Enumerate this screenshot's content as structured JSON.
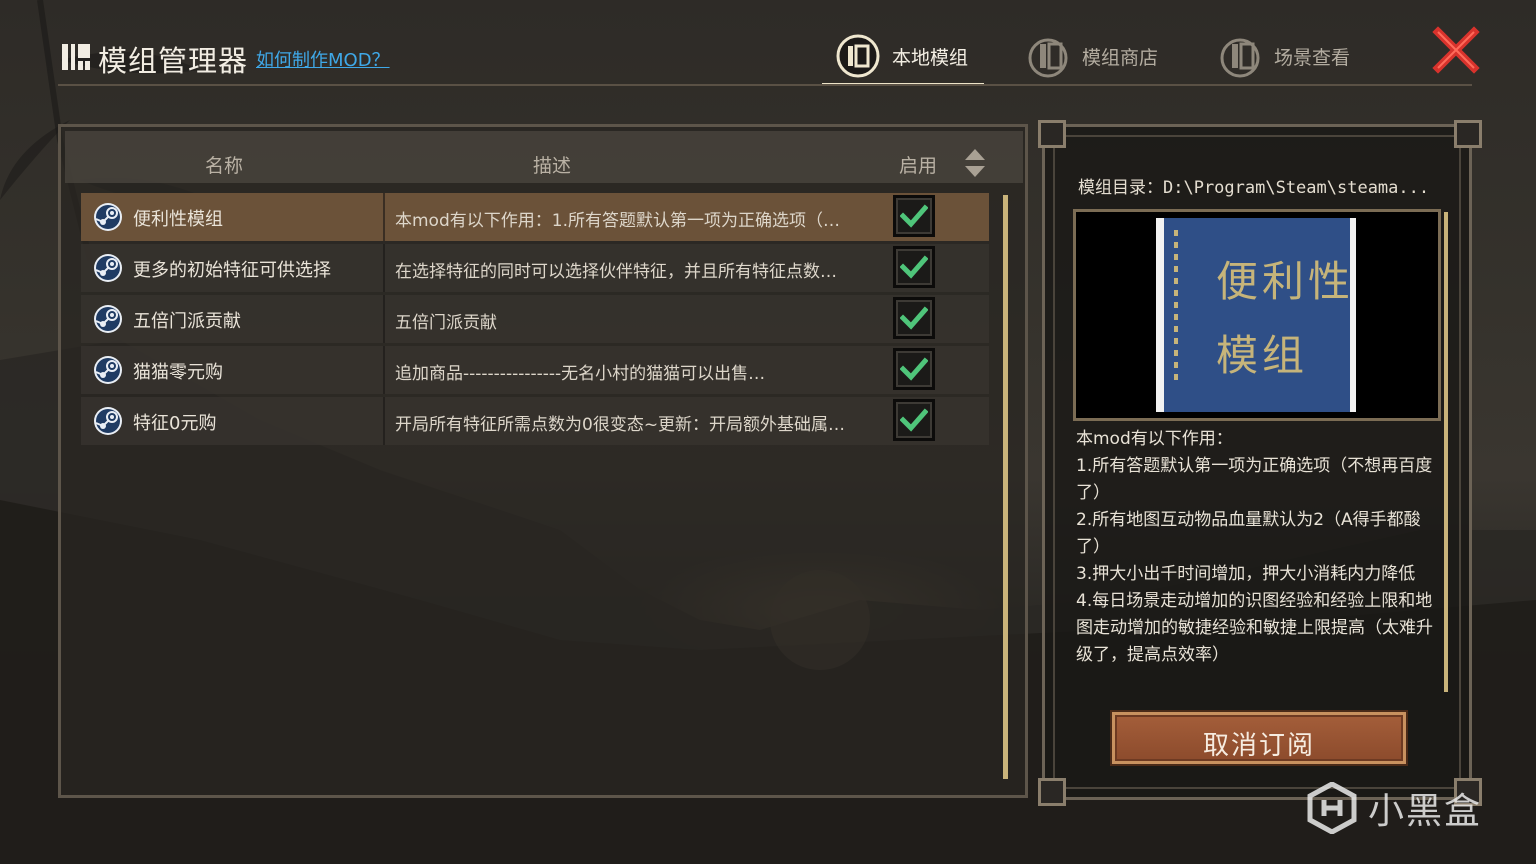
{
  "header": {
    "title": "模组管理器",
    "howto_link": "如何制作MOD？",
    "tabs": [
      {
        "label": "本地模组",
        "active": true
      },
      {
        "label": "模组商店",
        "active": false
      },
      {
        "label": "场景查看",
        "active": false
      }
    ]
  },
  "mod_list": {
    "columns": {
      "name": "名称",
      "desc": "描述",
      "enabled": "启用"
    },
    "rows": [
      {
        "name": "便利性模组",
        "desc": "本mod有以下作用：1.所有答题默认第一项为正确选项（…",
        "enabled": true,
        "selected": true
      },
      {
        "name": "更多的初始特征可供选择",
        "desc": "在选择特征的同时可以选择伙伴特征，并且所有特征点数…",
        "enabled": true,
        "selected": false
      },
      {
        "name": "五倍门派贡献",
        "desc": "五倍门派贡献",
        "enabled": true,
        "selected": false
      },
      {
        "name": "猫猫零元购",
        "desc": "追加商品----------------无名小村的猫猫可以出售…",
        "enabled": true,
        "selected": false
      },
      {
        "name": "特征0元购",
        "desc": "开局所有特征所需点数为0很变态~更新：开局额外基础属…",
        "enabled": true,
        "selected": false
      }
    ]
  },
  "detail": {
    "directory": "模组目录：D:\\Program\\Steam\\steama...",
    "preview_text_line1": "便利性",
    "preview_text_line2": "模组",
    "description": [
      "本mod有以下作用：",
      "1.所有答题默认第一项为正确选项（不想再百度了）",
      "2.所有地图互动物品血量默认为2（A得手都酸了）",
      "3.押大小出千时间增加，押大小消耗内力降低",
      "4.每日场景走动增加的识图经验和经验上限和地图走动增加的敏捷经验和敏捷上限提高（太难升级了，提高点效率）"
    ],
    "unsubscribe_label": "取消订阅"
  },
  "watermark": {
    "text": "小黑盒"
  },
  "colors": {
    "accent_gold": "#c9b37a",
    "selected_row": "#6b5239",
    "check_green": "#4fc57a",
    "close_red": "#d8322c",
    "link_blue": "#3fa8e8"
  }
}
